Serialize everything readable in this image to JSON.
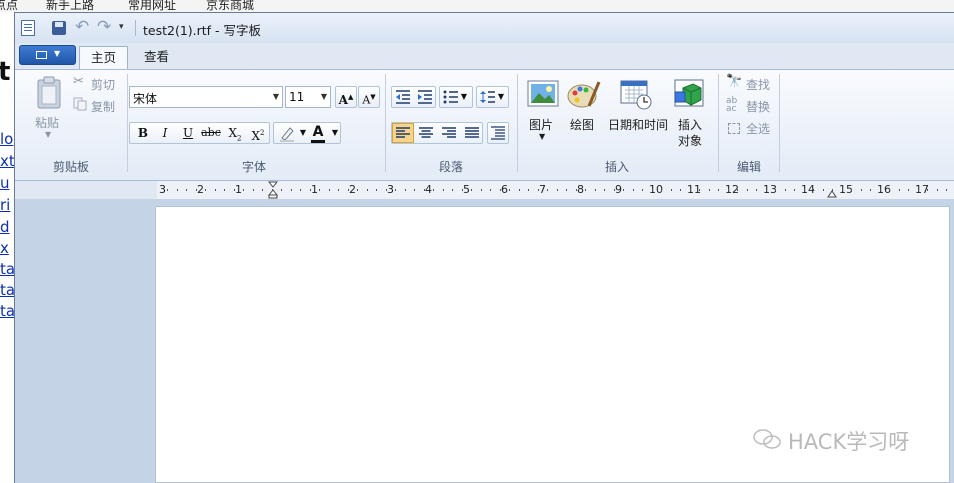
{
  "background_browser": {
    "bookmarks": [
      {
        "label": "点点"
      },
      {
        "label": "新手上路"
      },
      {
        "label": "常用网址"
      },
      {
        "label": "京东商城"
      }
    ],
    "heading_fragment": "t",
    "link_fragments": [
      "lo",
      "xt",
      "u",
      "ri",
      "d",
      "x",
      "ta",
      "ta",
      "ta"
    ]
  },
  "window": {
    "title": "test2(1).rtf - 写字板"
  },
  "tabs": [
    {
      "label": "主页",
      "active": true
    },
    {
      "label": "查看",
      "active": false
    }
  ],
  "groups": {
    "clipboard": {
      "label": "剪贴板",
      "paste": "粘贴",
      "cut": "剪切",
      "copy": "复制"
    },
    "font": {
      "label": "字体",
      "font_family": "宋体",
      "font_size": "11",
      "grow": "A",
      "shrink": "A",
      "bold": "B",
      "italic": "I",
      "underline": "U",
      "strike": "abc",
      "subscript": "X",
      "superscript": "X",
      "text_color": "A"
    },
    "paragraph": {
      "label": "段落"
    },
    "insert": {
      "label": "插入",
      "picture": "图片",
      "paint": "绘图",
      "datetime": "日期和时间",
      "object_line1": "插入",
      "object_line2": "对象"
    },
    "edit": {
      "label": "编辑",
      "find": "查找",
      "replace": "替换",
      "select_all": "全选"
    }
  },
  "ruler": {
    "labels": [
      "3",
      "2",
      "1",
      "1",
      "2",
      "3",
      "4",
      "5",
      "6",
      "7",
      "8",
      "9",
      "10",
      "11",
      "12",
      "13",
      "14",
      "15",
      "16",
      "17"
    ]
  },
  "watermark": "HACK学习呀",
  "colors": {
    "ribbon": "#e3ebf6",
    "accent": "#1f56a8",
    "active_align": "#f8d48a"
  }
}
